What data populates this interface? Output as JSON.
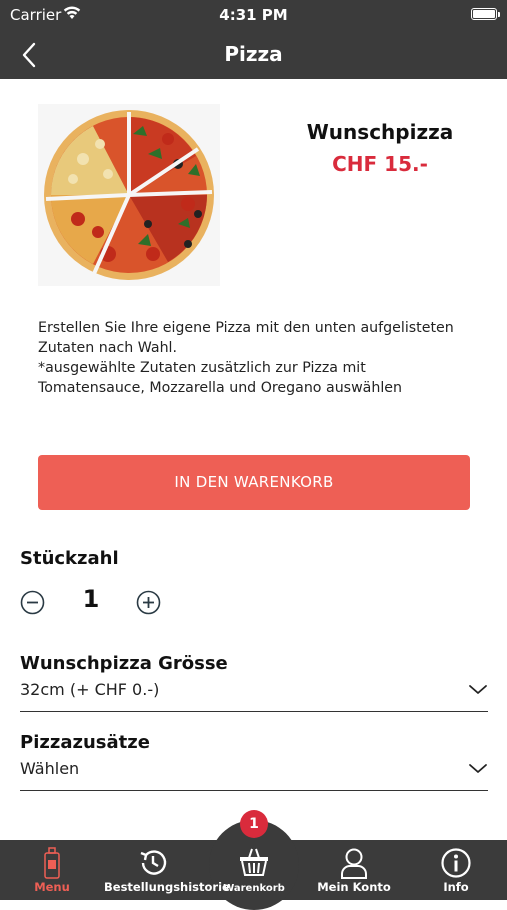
{
  "status_bar": {
    "carrier": "Carrier",
    "time": "4:31 PM"
  },
  "nav": {
    "title": "Pizza"
  },
  "product": {
    "name": "Wunschpizza",
    "price": "CHF 15.-",
    "description_lines": [
      "Erstellen Sie Ihre eigene Pizza mit den unten aufgelisteten",
      "Zutaten nach Wahl.",
      "*ausgewählte Zutaten zusätzlich zur Pizza mit",
      "Tomatensauce, Mozzarella und Oregano auswählen"
    ]
  },
  "add_to_cart": {
    "label": "IN DEN WARENKORB"
  },
  "quantity": {
    "label": "Stückzahl",
    "value": "1"
  },
  "size": {
    "label": "Wunschpizza Grösse",
    "value": "32cm (+ CHF 0.-)"
  },
  "extras": {
    "label": "Pizzazusätze",
    "value": "Wählen"
  },
  "tabs": {
    "menu": {
      "label": "Menu",
      "icon": "menu-bottle-icon"
    },
    "history": {
      "label": "Bestellungshistorie",
      "icon": "history-icon"
    },
    "cart": {
      "label": "Warenkorb",
      "icon": "basket-icon",
      "badge": "1"
    },
    "account": {
      "label": "Mein Konto",
      "icon": "user-icon"
    },
    "info": {
      "label": "Info",
      "icon": "info-icon"
    }
  },
  "colors": {
    "accent": "#ee5f55",
    "price": "#d92b3c",
    "bar": "#3b3b3b",
    "active_tab": "#ee5f55"
  }
}
